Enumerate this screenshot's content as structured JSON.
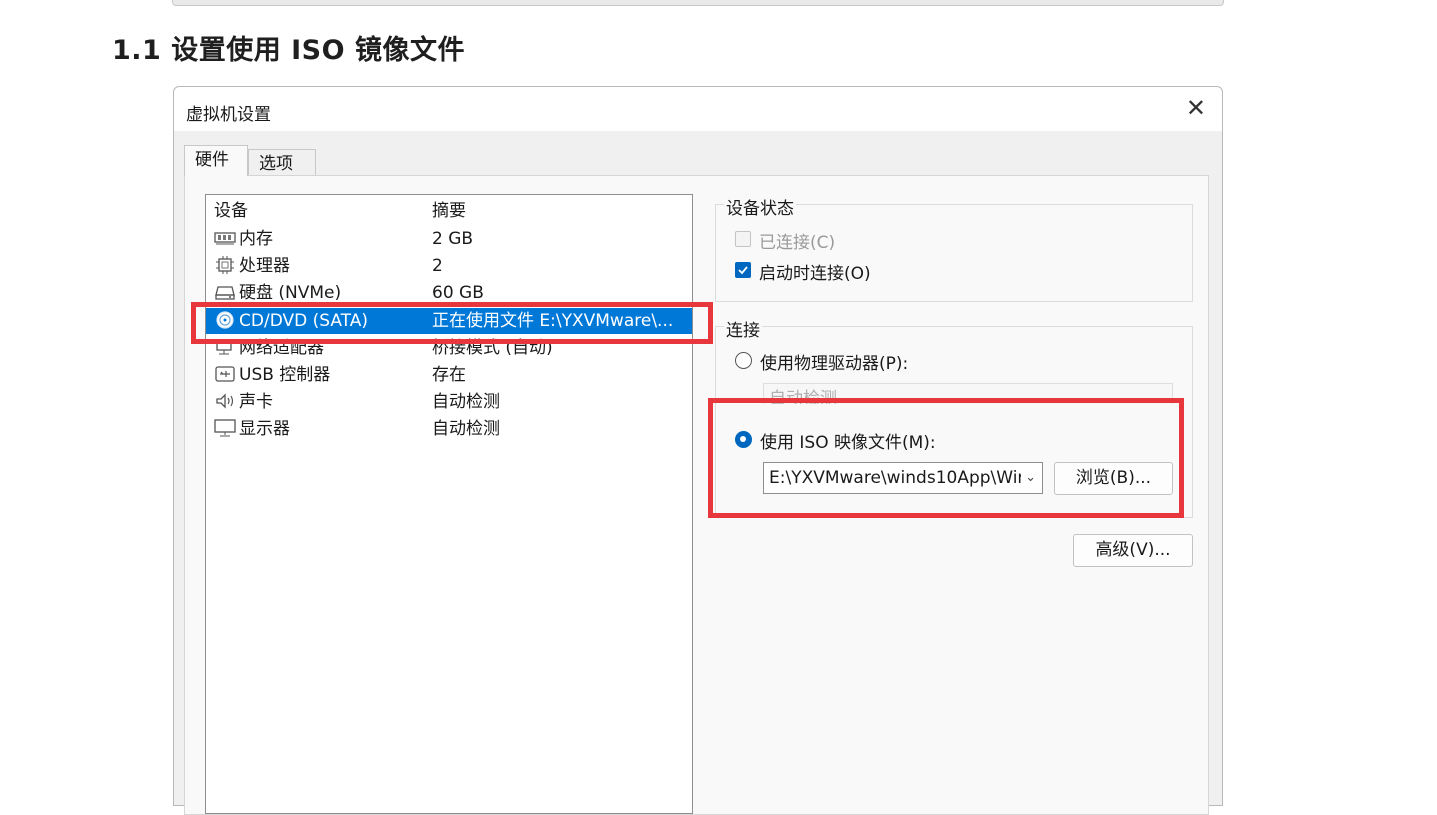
{
  "article": {
    "heading": "1.1 设置使用 ISO 镜像文件"
  },
  "dialog": {
    "title": "虚拟机设置",
    "close_glyph": "✕",
    "tabs": [
      {
        "label": "硬件",
        "active": true
      },
      {
        "label": "选项",
        "active": false
      }
    ],
    "device_list": {
      "headers": [
        "设备",
        "摘要"
      ],
      "rows": [
        {
          "icon": "memory-icon",
          "device": "内存",
          "summary": "2 GB"
        },
        {
          "icon": "cpu-icon",
          "device": "处理器",
          "summary": "2"
        },
        {
          "icon": "disk-icon",
          "device": "硬盘 (NVMe)",
          "summary": "60 GB"
        },
        {
          "icon": "cd-dvd-icon",
          "device": "CD/DVD (SATA)",
          "summary": "正在使用文件 E:\\YXVMware\\...",
          "selected": true
        },
        {
          "icon": "network-icon",
          "device": "网络适配器",
          "summary": "桥接模式 (自动)"
        },
        {
          "icon": "usb-icon",
          "device": "USB 控制器",
          "summary": "存在"
        },
        {
          "icon": "sound-icon",
          "device": "声卡",
          "summary": "自动检测"
        },
        {
          "icon": "display-icon",
          "device": "显示器",
          "summary": "自动检测"
        }
      ]
    },
    "device_status": {
      "label": "设备状态",
      "connected": {
        "label": "已连接(C)",
        "checked": false,
        "enabled": false
      },
      "connect_at_power_on": {
        "label": "启动时连接(O)",
        "checked": true
      }
    },
    "connection": {
      "label": "连接",
      "physical_drive": {
        "label": "使用物理驱动器(P):",
        "selected": false,
        "dropdown_value": "自动检测"
      },
      "iso_image": {
        "label": "使用 ISO 映像文件(M):",
        "selected": true,
        "path": "E:\\YXVMware\\winds10App\\Wir"
      },
      "browse_label": "浏览(B)...",
      "advanced_label": "高级(V)..."
    },
    "colors": {
      "selection": "#0078d7",
      "highlight_box": "#e8363d",
      "checkbox": "#0067c0"
    }
  }
}
